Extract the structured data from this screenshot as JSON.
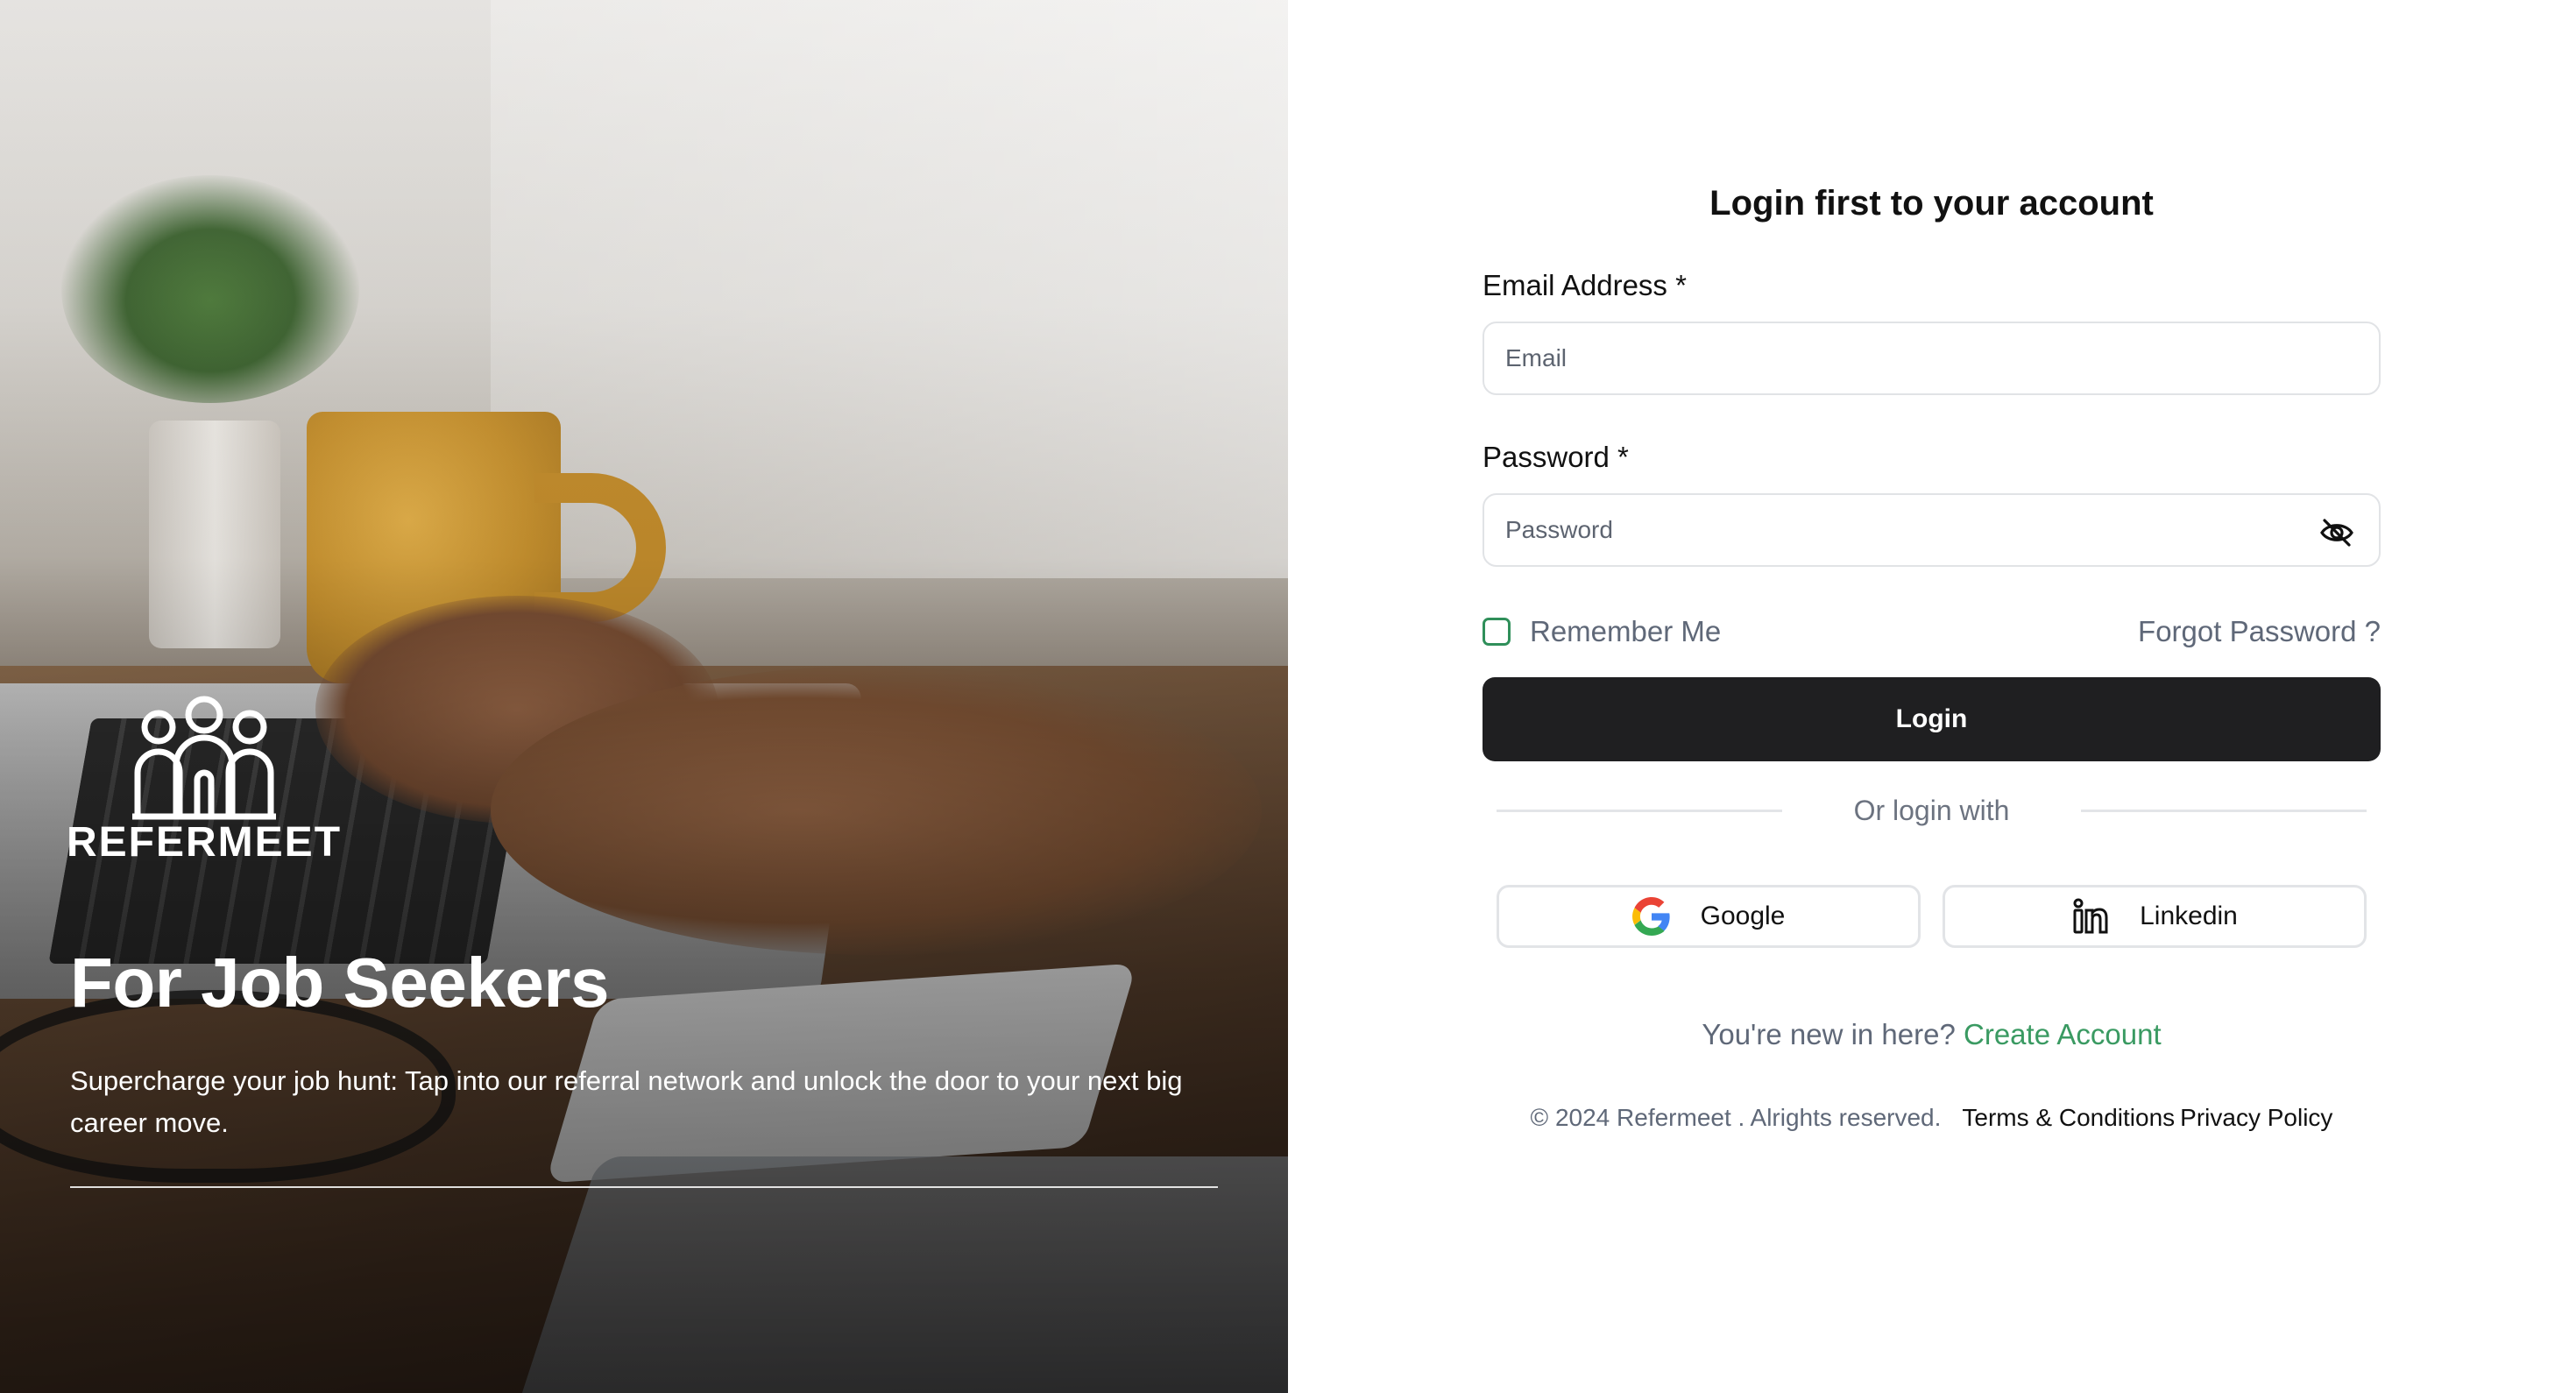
{
  "hero": {
    "brand_name": "REFERMEET",
    "title": "For Job Seekers",
    "description": "Supercharge your job hunt: Tap into our referral network and unlock the door to your next big career move."
  },
  "login": {
    "title": "Login first to your account",
    "email_label": "Email Address *",
    "email_placeholder": "Email",
    "email_value": "",
    "password_label": "Password *",
    "password_placeholder": "Password",
    "password_value": "",
    "password_toggle_icon": "eye-off-icon",
    "remember_label": "Remember Me",
    "remember_checked": false,
    "forgot_label": "Forgot Password ?",
    "login_button": "Login",
    "divider_text": "Or login with",
    "social": [
      {
        "label": "Google",
        "icon": "google-icon"
      },
      {
        "label": "Linkedin",
        "icon": "linkedin-icon"
      }
    ],
    "new_here_text": "You're new in here?",
    "create_account": "Create Account"
  },
  "footer": {
    "copyright": "© 2024 Refermeet . Alrights reserved.",
    "terms": "Terms & Conditions",
    "privacy": "Privacy Policy"
  },
  "colors": {
    "button_dark": "#1f1f21",
    "accent_green": "#3a9a62",
    "muted_text": "#5f6878"
  }
}
